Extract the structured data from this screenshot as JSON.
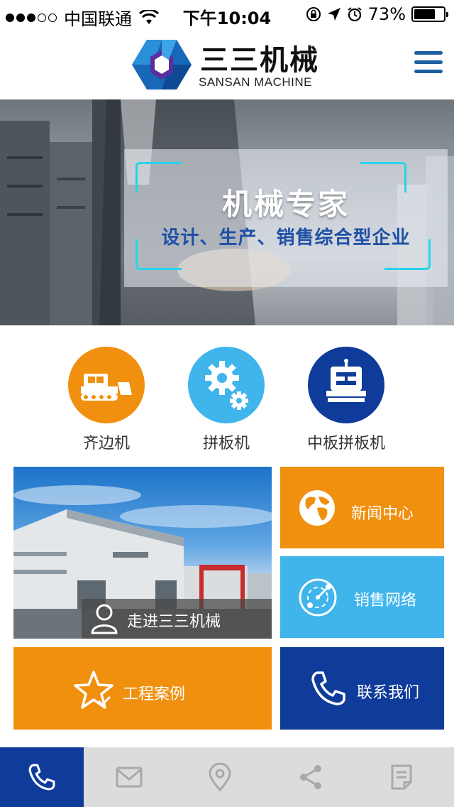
{
  "status_bar": {
    "carrier": "中国联通",
    "time": "下午10:04",
    "battery": "73%",
    "battery_level": 0.73
  },
  "header": {
    "logo_cn": "三三机械",
    "logo_en": "SANSAN MACHINE",
    "menu_icon": "hamburger-icon"
  },
  "banner": {
    "title": "机械专家",
    "subtitle": "设计、生产、销售综合型企业"
  },
  "categories": [
    {
      "label": "齐边机",
      "icon": "bulldozer-icon",
      "color": "#f0900e"
    },
    {
      "label": "拼板机",
      "icon": "gears-icon",
      "color": "#3fb5ec"
    },
    {
      "label": "中板拼板机",
      "icon": "machine-icon",
      "color": "#0f3b9a"
    }
  ],
  "tiles": {
    "about": {
      "label": "走进三三机械",
      "icon": "person-icon"
    },
    "news": {
      "label": "新闻中心",
      "icon": "globe-icon",
      "color": "#f0900e"
    },
    "sales": {
      "label": "销售网络",
      "icon": "network-icon",
      "color": "#3fb5ec"
    },
    "cases": {
      "label": "工程案例",
      "icon": "star-icon",
      "color": "#f0900e"
    },
    "contact": {
      "label": "联系我们",
      "icon": "phone-icon",
      "color": "#0f3b9a"
    }
  },
  "bottom_nav": [
    {
      "icon": "phone-icon",
      "active": true
    },
    {
      "icon": "mail-icon",
      "active": false
    },
    {
      "icon": "location-icon",
      "active": false
    },
    {
      "icon": "share-icon",
      "active": false
    },
    {
      "icon": "note-icon",
      "active": false
    }
  ]
}
